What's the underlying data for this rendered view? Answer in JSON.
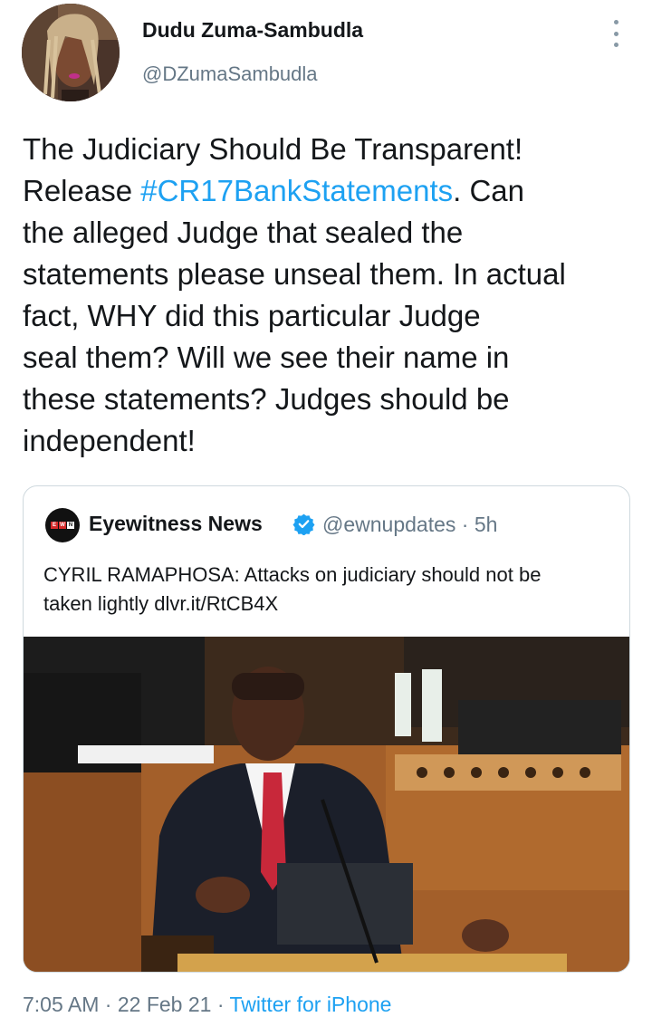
{
  "author": {
    "display_name": "Dudu Zuma-Sambudla",
    "handle": "@DZumaSambudla",
    "avatar_icon": "profile-photo"
  },
  "tweet": {
    "lines": [
      "The Judiciary Should Be Transparent!",
      {
        "before": "Release ",
        "hashtag": "#CR17BankStatements",
        "after": ". Can"
      },
      "the alleged Judge that sealed the",
      "statements please unseal them. In actual",
      "fact, WHY did this particular Judge",
      "seal them? Will we see their name in",
      "these statements? Judges should be",
      "independent!"
    ]
  },
  "quoted_tweet": {
    "name": "Eyewitness News",
    "handle": "@ewnupdates",
    "separator": "·",
    "age": "5h",
    "logo_letters": [
      "E",
      "W",
      "N"
    ],
    "text_lines": [
      "CYRIL RAMAPHOSA: Attacks on judiciary should not be",
      "taken lightly dlvr.it/RtCB4X"
    ]
  },
  "footer": {
    "time": "7:05 AM",
    "sep1": " · ",
    "date": "22 Feb 21",
    "sep2": " · ",
    "source": "Twitter for iPhone"
  },
  "colors": {
    "link": "#1da1f2",
    "secondary": "#657786",
    "text": "#14171a",
    "border": "#cfd9de"
  }
}
